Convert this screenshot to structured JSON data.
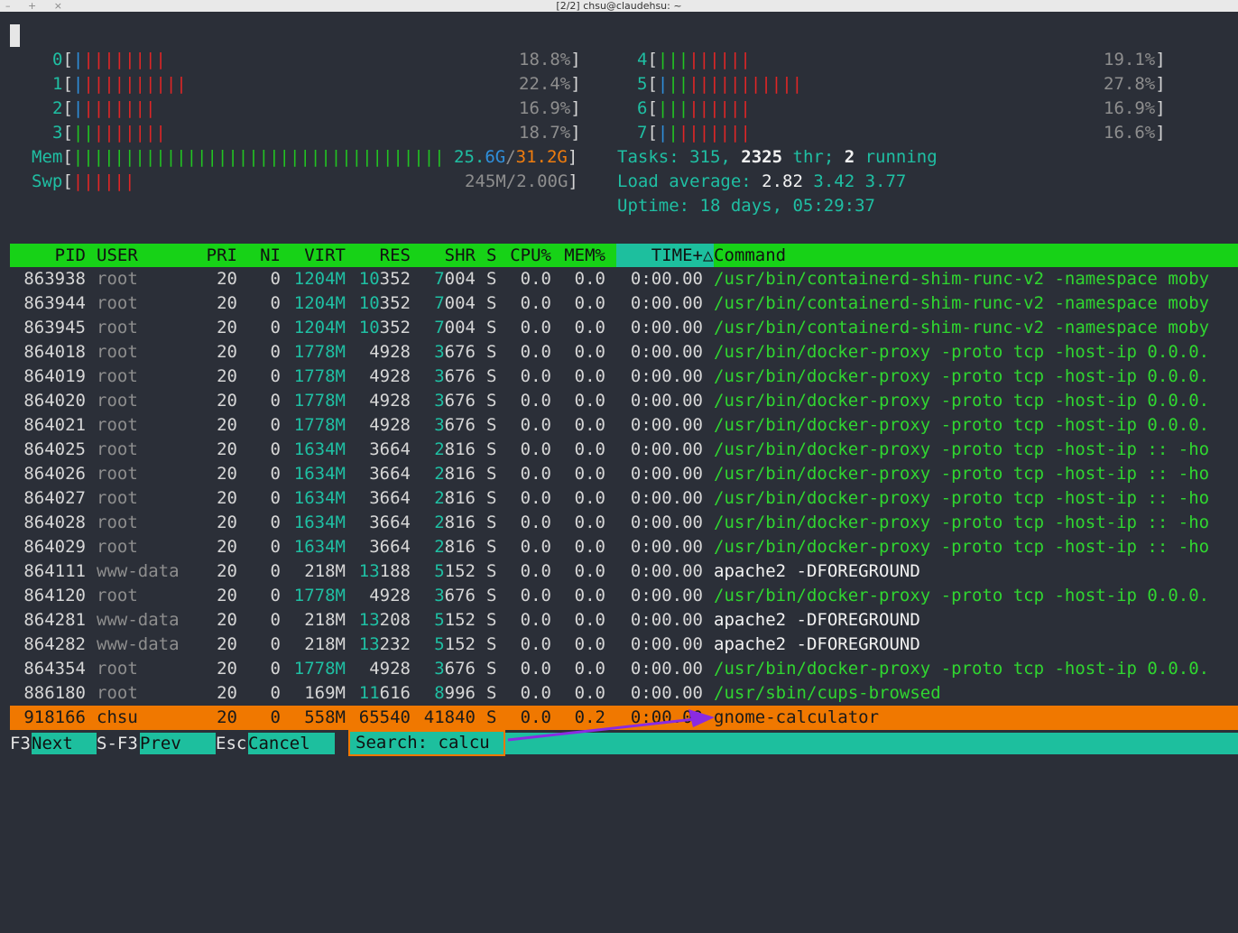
{
  "window": {
    "title": "[2/2] chsu@claudehsu: ~",
    "controls": "– + ×"
  },
  "cpus": [
    {
      "id": "0",
      "bars_blue": "|",
      "bars_green": "",
      "bars_red": "||||||||",
      "percent": "18.8%"
    },
    {
      "id": "1",
      "bars_blue": "|",
      "bars_green": "",
      "bars_red": "||||||||||",
      "percent": "22.4%"
    },
    {
      "id": "2",
      "bars_blue": "|",
      "bars_green": "",
      "bars_red": "|||||||",
      "percent": "16.9%"
    },
    {
      "id": "3",
      "bars_blue": "",
      "bars_green": "||",
      "bars_red": "|||||||",
      "percent": "18.7%"
    },
    {
      "id": "4",
      "bars_blue": "",
      "bars_green": "|||",
      "bars_red": "||||||",
      "percent": "19.1%"
    },
    {
      "id": "5",
      "bars_blue": "|",
      "bars_green": "||",
      "bars_red": "|||||||||||",
      "percent": "27.8%"
    },
    {
      "id": "6",
      "bars_blue": "",
      "bars_green": "|||",
      "bars_red": "||||||",
      "percent": "16.9%"
    },
    {
      "id": "7",
      "bars_blue": "|",
      "bars_green": "|",
      "bars_red": "|||||||",
      "percent": "16.6%"
    }
  ],
  "mem": {
    "label": "Mem",
    "bars": "||||||||||||||||||||||||||||||||||||",
    "used": "25.6G",
    "sep": "/",
    "total": "31.2G"
  },
  "swp": {
    "label": "Swp",
    "bars": "||||||",
    "value": "245M/2.00G"
  },
  "tasks": {
    "label": "Tasks: ",
    "count": "315",
    "sep": ", ",
    "threads": "2325",
    "thr_label": " thr; ",
    "running": "2",
    "running_label": " running"
  },
  "load": {
    "label": "Load average: ",
    "one": "2.82",
    "five": "3.42",
    "fifteen": "3.77"
  },
  "uptime": {
    "label": "Uptime: ",
    "value": "18 days, 05:29:37"
  },
  "columns": {
    "pid": "PID",
    "user": "USER",
    "pri": "PRI",
    "ni": "NI",
    "virt": "VIRT",
    "res": "RES",
    "shr": "SHR",
    "s": "S",
    "cpu": "CPU%",
    "mem": "MEM%",
    "time": "TIME+",
    "sort_glyph": "△",
    "command": "Command"
  },
  "processes": [
    {
      "pid": "863938",
      "user": "root",
      "pri": "20",
      "ni": "0",
      "virt": "1204M",
      "res_a": "10",
      "res_b": "352",
      "shr_a": "7",
      "shr_b": "004",
      "s": "S",
      "cpu": "0.0",
      "mem": "0.0",
      "time": "0:00.00",
      "command": "/usr/bin/containerd-shim-runc-v2 -namespace moby",
      "green": true
    },
    {
      "pid": "863944",
      "user": "root",
      "pri": "20",
      "ni": "0",
      "virt": "1204M",
      "res_a": "10",
      "res_b": "352",
      "shr_a": "7",
      "shr_b": "004",
      "s": "S",
      "cpu": "0.0",
      "mem": "0.0",
      "time": "0:00.00",
      "command": "/usr/bin/containerd-shim-runc-v2 -namespace moby",
      "green": true
    },
    {
      "pid": "863945",
      "user": "root",
      "pri": "20",
      "ni": "0",
      "virt": "1204M",
      "res_a": "10",
      "res_b": "352",
      "shr_a": "7",
      "shr_b": "004",
      "s": "S",
      "cpu": "0.0",
      "mem": "0.0",
      "time": "0:00.00",
      "command": "/usr/bin/containerd-shim-runc-v2 -namespace moby",
      "green": true
    },
    {
      "pid": "864018",
      "user": "root",
      "pri": "20",
      "ni": "0",
      "virt": "1778M",
      "res_a": "",
      "res_b": "4928",
      "shr_a": "3",
      "shr_b": "676",
      "s": "S",
      "cpu": "0.0",
      "mem": "0.0",
      "time": "0:00.00",
      "command": "/usr/bin/docker-proxy -proto tcp -host-ip 0.0.0.",
      "green": true
    },
    {
      "pid": "864019",
      "user": "root",
      "pri": "20",
      "ni": "0",
      "virt": "1778M",
      "res_a": "",
      "res_b": "4928",
      "shr_a": "3",
      "shr_b": "676",
      "s": "S",
      "cpu": "0.0",
      "mem": "0.0",
      "time": "0:00.00",
      "command": "/usr/bin/docker-proxy -proto tcp -host-ip 0.0.0.",
      "green": true
    },
    {
      "pid": "864020",
      "user": "root",
      "pri": "20",
      "ni": "0",
      "virt": "1778M",
      "res_a": "",
      "res_b": "4928",
      "shr_a": "3",
      "shr_b": "676",
      "s": "S",
      "cpu": "0.0",
      "mem": "0.0",
      "time": "0:00.00",
      "command": "/usr/bin/docker-proxy -proto tcp -host-ip 0.0.0.",
      "green": true
    },
    {
      "pid": "864021",
      "user": "root",
      "pri": "20",
      "ni": "0",
      "virt": "1778M",
      "res_a": "",
      "res_b": "4928",
      "shr_a": "3",
      "shr_b": "676",
      "s": "S",
      "cpu": "0.0",
      "mem": "0.0",
      "time": "0:00.00",
      "command": "/usr/bin/docker-proxy -proto tcp -host-ip 0.0.0.",
      "green": true
    },
    {
      "pid": "864025",
      "user": "root",
      "pri": "20",
      "ni": "0",
      "virt": "1634M",
      "res_a": "",
      "res_b": "3664",
      "shr_a": "2",
      "shr_b": "816",
      "s": "S",
      "cpu": "0.0",
      "mem": "0.0",
      "time": "0:00.00",
      "command": "/usr/bin/docker-proxy -proto tcp -host-ip :: -ho",
      "green": true
    },
    {
      "pid": "864026",
      "user": "root",
      "pri": "20",
      "ni": "0",
      "virt": "1634M",
      "res_a": "",
      "res_b": "3664",
      "shr_a": "2",
      "shr_b": "816",
      "s": "S",
      "cpu": "0.0",
      "mem": "0.0",
      "time": "0:00.00",
      "command": "/usr/bin/docker-proxy -proto tcp -host-ip :: -ho",
      "green": true
    },
    {
      "pid": "864027",
      "user": "root",
      "pri": "20",
      "ni": "0",
      "virt": "1634M",
      "res_a": "",
      "res_b": "3664",
      "shr_a": "2",
      "shr_b": "816",
      "s": "S",
      "cpu": "0.0",
      "mem": "0.0",
      "time": "0:00.00",
      "command": "/usr/bin/docker-proxy -proto tcp -host-ip :: -ho",
      "green": true
    },
    {
      "pid": "864028",
      "user": "root",
      "pri": "20",
      "ni": "0",
      "virt": "1634M",
      "res_a": "",
      "res_b": "3664",
      "shr_a": "2",
      "shr_b": "816",
      "s": "S",
      "cpu": "0.0",
      "mem": "0.0",
      "time": "0:00.00",
      "command": "/usr/bin/docker-proxy -proto tcp -host-ip :: -ho",
      "green": true
    },
    {
      "pid": "864029",
      "user": "root",
      "pri": "20",
      "ni": "0",
      "virt": "1634M",
      "res_a": "",
      "res_b": "3664",
      "shr_a": "2",
      "shr_b": "816",
      "s": "S",
      "cpu": "0.0",
      "mem": "0.0",
      "time": "0:00.00",
      "command": "/usr/bin/docker-proxy -proto tcp -host-ip :: -ho",
      "green": true
    },
    {
      "pid": "864111",
      "user": "www-data",
      "pri": "20",
      "ni": "0",
      "virt": "218M",
      "res_a": "13",
      "res_b": "188",
      "shr_a": "5",
      "shr_b": "152",
      "s": "S",
      "cpu": "0.0",
      "mem": "0.0",
      "time": "0:00.00",
      "command": "apache2 -DFOREGROUND",
      "green": false
    },
    {
      "pid": "864120",
      "user": "root",
      "pri": "20",
      "ni": "0",
      "virt": "1778M",
      "res_a": "",
      "res_b": "4928",
      "shr_a": "3",
      "shr_b": "676",
      "s": "S",
      "cpu": "0.0",
      "mem": "0.0",
      "time": "0:00.00",
      "command": "/usr/bin/docker-proxy -proto tcp -host-ip 0.0.0.",
      "green": true
    },
    {
      "pid": "864281",
      "user": "www-data",
      "pri": "20",
      "ni": "0",
      "virt": "218M",
      "res_a": "13",
      "res_b": "208",
      "shr_a": "5",
      "shr_b": "152",
      "s": "S",
      "cpu": "0.0",
      "mem": "0.0",
      "time": "0:00.00",
      "command": "apache2 -DFOREGROUND",
      "green": false
    },
    {
      "pid": "864282",
      "user": "www-data",
      "pri": "20",
      "ni": "0",
      "virt": "218M",
      "res_a": "13",
      "res_b": "232",
      "shr_a": "5",
      "shr_b": "152",
      "s": "S",
      "cpu": "0.0",
      "mem": "0.0",
      "time": "0:00.00",
      "command": "apache2 -DFOREGROUND",
      "green": false
    },
    {
      "pid": "864354",
      "user": "root",
      "pri": "20",
      "ni": "0",
      "virt": "1778M",
      "res_a": "",
      "res_b": "4928",
      "shr_a": "3",
      "shr_b": "676",
      "s": "S",
      "cpu": "0.0",
      "mem": "0.0",
      "time": "0:00.00",
      "command": "/usr/bin/docker-proxy -proto tcp -host-ip 0.0.0.",
      "green": true
    },
    {
      "pid": "886180",
      "user": "root",
      "pri": "20",
      "ni": "0",
      "virt": "169M",
      "res_a": "11",
      "res_b": "616",
      "shr_a": "8",
      "shr_b": "996",
      "s": "S",
      "cpu": "0.0",
      "mem": "0.0",
      "time": "0:00.00",
      "command": "/usr/sbin/cups-browsed",
      "green": true
    },
    {
      "pid": "918166",
      "user": "chsu",
      "pri": "20",
      "ni": "0",
      "virt": "558M",
      "res_a": "",
      "res_b": "65540",
      "shr_a": "",
      "shr_b": "41840",
      "s": "S",
      "cpu": "0.0",
      "mem": "0.2",
      "time": "0:00.00",
      "command": "gnome-calculator",
      "green": false,
      "selected": true
    }
  ],
  "footer": {
    "f3_key": "F3",
    "f3_label": "Next",
    "sf3_key": "S-F3",
    "sf3_label": "Prev",
    "esc_key": "Esc",
    "esc_label": "Cancel",
    "search_label": "Search: ",
    "search_value": "calcu"
  },
  "colors": {
    "background": "#2b2f38",
    "header": "#17d217",
    "selected_row": "#f07800",
    "annotation_arrow": "#8a2be2"
  }
}
